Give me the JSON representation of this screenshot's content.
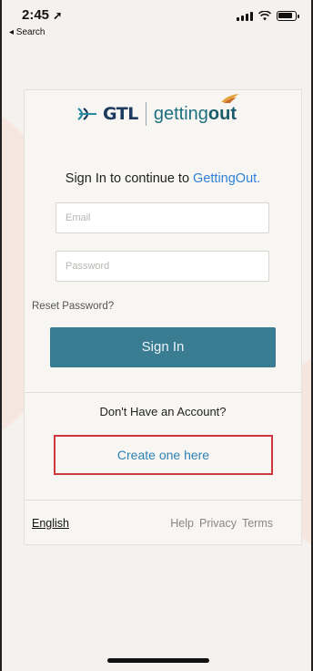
{
  "status_bar": {
    "time": "2:45",
    "back_label": "◂ Search"
  },
  "logo": {
    "left_brand": "GTL",
    "right_brand_prefix": "getting",
    "right_brand_suffix": "out"
  },
  "signin": {
    "headline_prefix": "Sign In to continue to ",
    "headline_brand": "GettingOut.",
    "email_placeholder": "Email",
    "password_placeholder": "Password",
    "reset_label": "Reset Password?",
    "button_label": "Sign In"
  },
  "account": {
    "prompt": "Don't Have an Account?",
    "create_label": "Create one here"
  },
  "footer": {
    "language": "English",
    "links": [
      "Help",
      "Privacy",
      "Terms"
    ]
  },
  "colors": {
    "primary_button": "#3a7d92",
    "link_blue": "#2f7fd8",
    "highlight_red": "#d0363d",
    "background": "#f4f1ee"
  }
}
